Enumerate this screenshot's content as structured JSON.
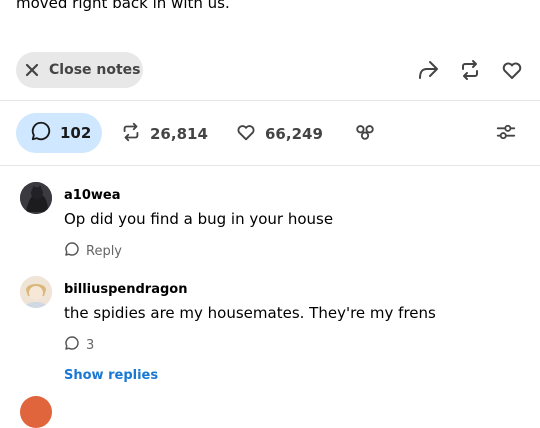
{
  "post": {
    "text_fragment": "moved right back in with us."
  },
  "toolbar": {
    "close_notes_label": "Close notes",
    "icons": [
      "share-icon",
      "reblog-icon",
      "like-icon"
    ]
  },
  "notes_bar": {
    "comments_count": "102",
    "reblogs_count": "26,814",
    "likes_count": "66,249",
    "accent_color": "#cfe7ff",
    "icons": [
      "comment-icon",
      "reblog-icon",
      "heart-icon",
      "community-icon",
      "filter-icon"
    ]
  },
  "replies": [
    {
      "username": "a10wea",
      "text": "Op did you find a bug in your house",
      "action_label": "Reply"
    },
    {
      "username": "billiuspendragon",
      "text": "the spidies are my housemates. They're my frens",
      "reply_count": "3",
      "show_replies_label": "Show replies"
    }
  ],
  "colors": {
    "link_blue": "#1a78d2",
    "pill_gray": "#e8e8e8"
  }
}
